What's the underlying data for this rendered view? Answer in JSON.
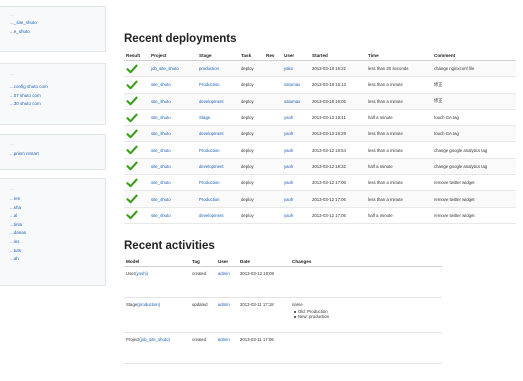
{
  "sidebar": {
    "sections": [
      {
        "heading": "...",
        "links": [
          "..._site_shuto",
          "...e_shuto"
        ]
      },
      {
        "heading": "...",
        "links": [
          "...config shuto com",
          "...07 shuto com",
          "...30 shuto com"
        ]
      },
      {
        "heading": "...",
        "links": [
          "...prism restart"
        ]
      },
      {
        "heading": "...",
        "links": [
          "...ren",
          "...sha",
          "...al",
          "...tinla",
          "...danas",
          "...ins",
          "...tuts",
          "...ah"
        ]
      }
    ]
  },
  "deployments": {
    "title": "Recent deployments",
    "columns": [
      "Result",
      "Project",
      "Stage",
      "Task",
      "Rev",
      "User",
      "Started",
      "Time",
      "Comment"
    ],
    "rows": [
      {
        "result": "success",
        "project": "job_site_shuto",
        "stage": "production",
        "task": "deploy",
        "rev": "",
        "user": "yako",
        "started": "2013-03-18 16:22",
        "time": "less than 20 seconds",
        "comment": "change nginxconf file"
      },
      {
        "result": "success",
        "project": "site_shuto",
        "stage": "Production",
        "task": "deploy",
        "rev": "",
        "user": "satomax",
        "started": "2013-03-18 16:13",
        "time": "less than a minute",
        "comment": "修正"
      },
      {
        "result": "success",
        "project": "site_shuto",
        "stage": "development",
        "task": "deploy",
        "rev": "",
        "user": "satomax",
        "started": "2013-03-18 16:05",
        "time": "less than a minute",
        "comment": "修正"
      },
      {
        "result": "success",
        "project": "site_shuto",
        "stage": "Stage",
        "task": "deploy",
        "rev": "",
        "user": "yaoh",
        "started": "2013-03-13 18:41",
        "time": "half a minute",
        "comment": "touch GA tag"
      },
      {
        "result": "success",
        "project": "site_shuto",
        "stage": "development",
        "task": "deploy",
        "rev": "",
        "user": "yaoh",
        "started": "2013-03-13 18:29",
        "time": "less than a minute",
        "comment": "touch GA tag"
      },
      {
        "result": "success",
        "project": "site_shuto",
        "stage": "Production",
        "task": "deploy",
        "rev": "",
        "user": "yaoh",
        "started": "2013-03-12 18:54",
        "time": "less than a minute",
        "comment": "change google analytics tag"
      },
      {
        "result": "success",
        "project": "site_shuto",
        "stage": "development",
        "task": "deploy",
        "rev": "",
        "user": "yaoh",
        "started": "2013-03-12 18:32",
        "time": "half a minute",
        "comment": "change google analytics tag"
      },
      {
        "result": "success",
        "project": "site_shuto",
        "stage": "Production",
        "task": "deploy",
        "rev": "",
        "user": "yaoh",
        "started": "2013-03-12 17:06",
        "time": "less than a minute",
        "comment": "remove twitter widget"
      },
      {
        "result": "success",
        "project": "site_shuto",
        "stage": "Production",
        "task": "deploy",
        "rev": "",
        "user": "yaoh",
        "started": "2013-03-12 17:06",
        "time": "less than a minute",
        "comment": "remove twitter widget"
      },
      {
        "result": "success",
        "project": "site_shuto",
        "stage": "development",
        "task": "deploy",
        "rev": "",
        "user": "yaoh",
        "started": "2013-03-12 17:06",
        "time": "half a minute",
        "comment": "remove twitter widget"
      }
    ]
  },
  "activities": {
    "title": "Recent activities",
    "columns": [
      "Model",
      "Tag",
      "User",
      "Date",
      "Changes"
    ],
    "rows": [
      {
        "model": "User",
        "model_link": "(yoshi)",
        "tag": "created",
        "user": "admin",
        "date": "2013-03-12 18:08",
        "changes_title": "",
        "changes": []
      },
      {
        "model": "Stage",
        "model_link": "(production)",
        "tag": "updated",
        "user": "admin",
        "date": "2013-03-11 17:18",
        "changes_title": "name",
        "changes": [
          "Old: Production",
          "New: production"
        ]
      },
      {
        "model": "Project",
        "model_link": "(job_site_shuto)",
        "tag": "created",
        "user": "admin",
        "date": "2013-03-11 17:08",
        "changes_title": "",
        "changes": []
      }
    ]
  },
  "colors": {
    "link": "#1a5fb4",
    "success": "#3a9c1a"
  },
  "icons": {
    "result_success": "check-icon"
  }
}
